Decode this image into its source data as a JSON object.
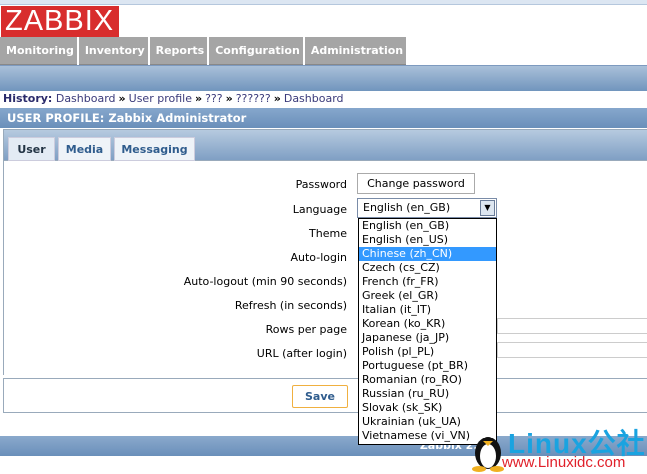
{
  "logo": "ZABBIX",
  "nav": [
    "Monitoring",
    "Inventory",
    "Reports",
    "Configuration",
    "Administration"
  ],
  "history": {
    "label": "History:",
    "items": [
      "Dashboard",
      "User profile",
      "???",
      "??????",
      "Dashboard"
    ],
    "sep": "»"
  },
  "header": "USER PROFILE: Zabbix Administrator",
  "tabs": [
    "User",
    "Media",
    "Messaging"
  ],
  "form": {
    "password_label": "Password",
    "change_password": "Change password",
    "language_label": "Language",
    "language_value": "English (en_GB)",
    "theme_label": "Theme",
    "autologin_label": "Auto-login",
    "autologout_label": "Auto-logout (min 90 seconds)",
    "refresh_label": "Refresh (in seconds)",
    "rows_label": "Rows per page",
    "url_label": "URL (after login)"
  },
  "language_options": [
    "English (en_GB)",
    "English (en_US)",
    "Chinese (zh_CN)",
    "Czech (cs_CZ)",
    "French (fr_FR)",
    "Greek (el_GR)",
    "Italian (it_IT)",
    "Korean (ko_KR)",
    "Japanese (ja_JP)",
    "Polish (pl_PL)",
    "Portuguese (pt_BR)",
    "Romanian (ro_RO)",
    "Russian (ru_RU)",
    "Slovak (sk_SK)",
    "Ukrainian (uk_UA)",
    "Vietnamese (vi_VN)"
  ],
  "highlighted_option": "Chinese (zh_CN)",
  "save": "Save",
  "footer": "Zabbix 2.2.1",
  "watermark": {
    "brand": "Linux公社",
    "url": "www.Linuxidc.com"
  }
}
